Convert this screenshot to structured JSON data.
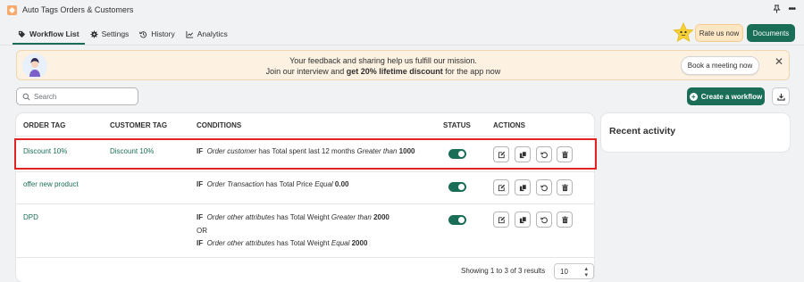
{
  "window": {
    "title": "Auto Tags Orders & Customers",
    "pin_icon": "pin-icon",
    "more_icon": "more-horizontal-icon"
  },
  "tabs": [
    {
      "label": "Workflow List",
      "icon": "tag-icon",
      "active": true
    },
    {
      "label": "Settings",
      "icon": "gear-icon",
      "active": false
    },
    {
      "label": "History",
      "icon": "history-icon",
      "active": false
    },
    {
      "label": "Analytics",
      "icon": "chart-icon",
      "active": false
    }
  ],
  "header_buttons": {
    "rate": "Rate us now",
    "documents": "Documents"
  },
  "banner": {
    "line1": "Your feedback and sharing help us fulfill our mission.",
    "line2_prefix": "Join our interview and ",
    "line2_bold": "get 20% lifetime discount",
    "line2_suffix": " for the app now",
    "button": "Book a meeting now",
    "close": "✕"
  },
  "search": {
    "placeholder": "Search",
    "value": ""
  },
  "create_button": "Create a workflow",
  "table": {
    "headers": {
      "order_tag": "ORDER TAG",
      "customer_tag": "CUSTOMER TAG",
      "conditions": "CONDITIONS",
      "status": "STATUS",
      "actions": "ACTIONS"
    },
    "rows": [
      {
        "order_tag": "Discount 10%",
        "customer_tag": "Discount 10%",
        "conditions": [
          {
            "kw": "IF",
            "object": "Order customer",
            "has": " has Total spent last 12 months ",
            "op": "Greater than",
            "value": "1000"
          }
        ],
        "status_on": true
      },
      {
        "order_tag": "offer new product",
        "customer_tag": "",
        "conditions": [
          {
            "kw": "IF",
            "object": "Order Transaction",
            "has": " has Total Price ",
            "op": "Equal",
            "value": "0.00"
          }
        ],
        "status_on": true
      },
      {
        "order_tag": "DPD",
        "customer_tag": "",
        "conditions": [
          {
            "kw": "IF",
            "object": "Order other attributes",
            "has": " has Total Weight ",
            "op": "Greater than",
            "value": "2000"
          },
          {
            "kw": "OR"
          },
          {
            "kw": "IF",
            "object": "Order other attributes",
            "has": " has Total Weight ",
            "op": "Equal",
            "value": "2000"
          }
        ],
        "status_on": true
      }
    ]
  },
  "action_icons": [
    "edit-icon",
    "duplicate-icon",
    "history-icon",
    "delete-icon"
  ],
  "pagination": {
    "summary": "Showing 1 to 3 of 3 results",
    "page_size": "10"
  },
  "recent_activity": {
    "title": "Recent activity"
  },
  "colors": {
    "brand_green": "#1a6e58",
    "highlight_red": "#e02424",
    "banner_bg": "#fdf1e1"
  }
}
